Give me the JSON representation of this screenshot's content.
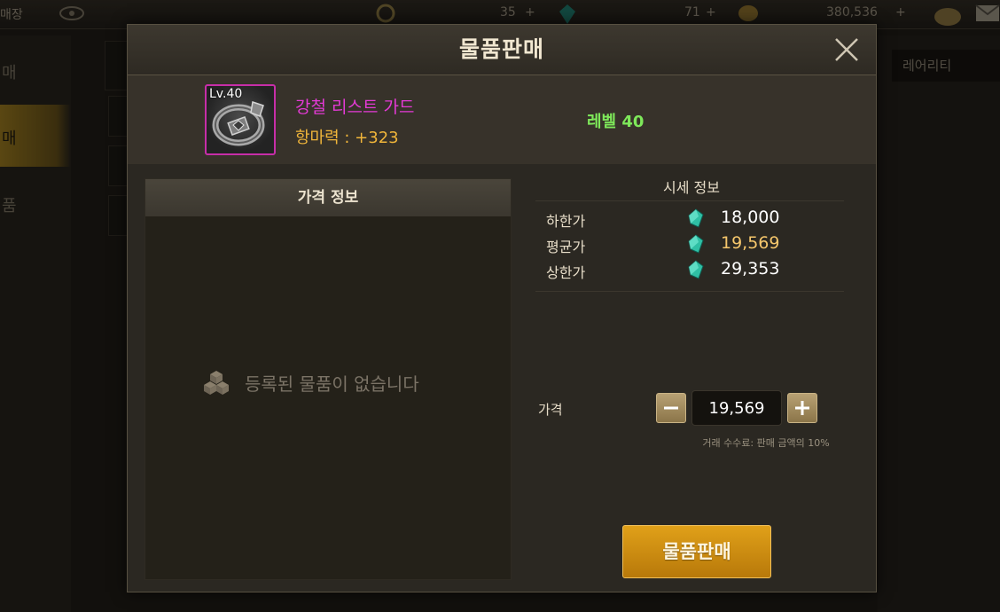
{
  "background": {
    "topbar": {
      "left_label": "매장",
      "count_a": "35",
      "count_b": "71",
      "gold": "380,536"
    },
    "sidebar": [
      "매",
      "매",
      "품"
    ],
    "rarity_filter": "레어리티"
  },
  "modal": {
    "title": "물품판매",
    "item": {
      "level_badge": "Lv.40",
      "name": "강철 리스트 가드",
      "stat": "항마력 : +323",
      "requirement": "레벨 40",
      "rarity_color": "#e53ad6"
    },
    "price_info": {
      "header": "가격 정보",
      "empty_message": "등록된 물품이 없습니다"
    },
    "market": {
      "header": "시세 정보",
      "rows": [
        {
          "label": "하한가",
          "value": "18,000"
        },
        {
          "label": "평균가",
          "value": "19,569"
        },
        {
          "label": "상한가",
          "value": "29,353"
        }
      ]
    },
    "price": {
      "label": "가격",
      "value": "19,569",
      "fee_note": "거래 수수료: 판매 금액의 10%"
    },
    "sell_button": "물품판매"
  }
}
